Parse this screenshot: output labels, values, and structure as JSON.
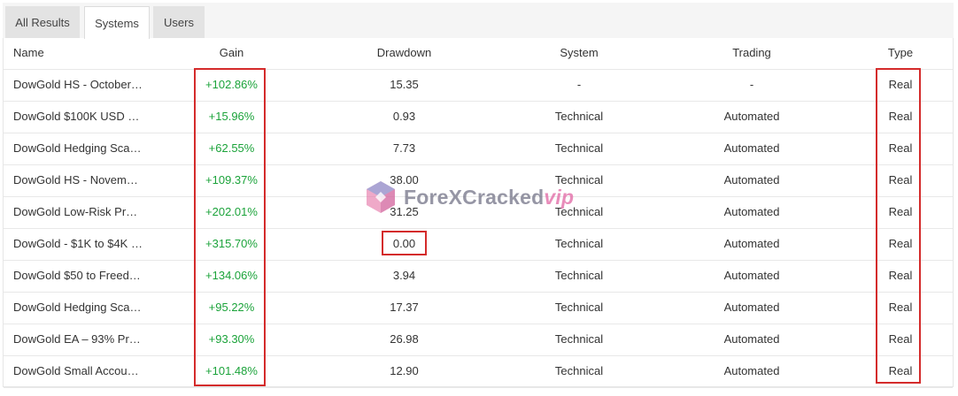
{
  "tabs": [
    {
      "label": "All Results",
      "active": false
    },
    {
      "label": "Systems",
      "active": true
    },
    {
      "label": "Users",
      "active": false
    }
  ],
  "columns": {
    "name": "Name",
    "gain": "Gain",
    "drawdown": "Drawdown",
    "system": "System",
    "trading": "Trading",
    "type": "Type"
  },
  "rows": [
    {
      "name": "DowGold HS - October…",
      "gain": "+102.86%",
      "drawdown": "15.35",
      "system": "-",
      "trading": "-",
      "type": "Real"
    },
    {
      "name": "DowGold $100K USD …",
      "gain": "+15.96%",
      "drawdown": "0.93",
      "system": "Technical",
      "trading": "Automated",
      "type": "Real"
    },
    {
      "name": "DowGold Hedging Sca…",
      "gain": "+62.55%",
      "drawdown": "7.73",
      "system": "Technical",
      "trading": "Automated",
      "type": "Real"
    },
    {
      "name": "DowGold HS - Novem…",
      "gain": "+109.37%",
      "drawdown": "38.00",
      "system": "Technical",
      "trading": "Automated",
      "type": "Real"
    },
    {
      "name": "DowGold Low-Risk Pr…",
      "gain": "+202.01%",
      "drawdown": "31.25",
      "system": "Technical",
      "trading": "Automated",
      "type": "Real"
    },
    {
      "name": "DowGold - $1K to $4K …",
      "gain": "+315.70%",
      "drawdown": "0.00",
      "system": "Technical",
      "trading": "Automated",
      "type": "Real"
    },
    {
      "name": "DowGold $50 to Freed…",
      "gain": "+134.06%",
      "drawdown": "3.94",
      "system": "Technical",
      "trading": "Automated",
      "type": "Real"
    },
    {
      "name": "DowGold Hedging Sca…",
      "gain": "+95.22%",
      "drawdown": "17.37",
      "system": "Technical",
      "trading": "Automated",
      "type": "Real"
    },
    {
      "name": "DowGold EA – 93% Pr…",
      "gain": "+93.30%",
      "drawdown": "26.98",
      "system": "Technical",
      "trading": "Automated",
      "type": "Real"
    },
    {
      "name": "DowGold Small Accou…",
      "gain": "+101.48%",
      "drawdown": "12.90",
      "system": "Technical",
      "trading": "Automated",
      "type": "Real"
    }
  ],
  "watermark": {
    "text": "ForeXCracked",
    "suffix": "vip"
  },
  "colors": {
    "gain_positive": "#1ba33a",
    "highlight_box": "#d42b2b",
    "active_tab": "#ffffff",
    "inactive_tab": "#e3e3e3"
  }
}
